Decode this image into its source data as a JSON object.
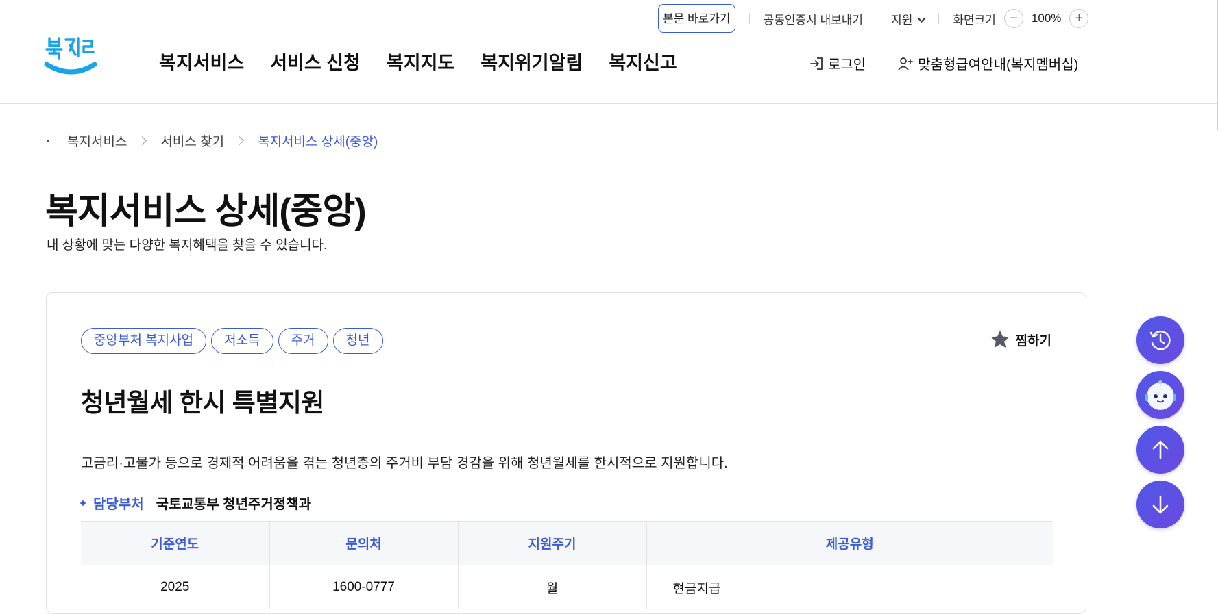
{
  "utility": {
    "skip_link": "본문 바로가기",
    "cert_export": "공동인증서 내보내기",
    "support": "지원",
    "screen_size": "화면크기",
    "zoom_minus": "−",
    "zoom_value": "100%",
    "zoom_plus": "+"
  },
  "header": {
    "logo_text": "복지로",
    "nav": [
      "복지서비스",
      "서비스 신청",
      "복지지도",
      "복지위기알림",
      "복지신고"
    ],
    "login": "로그인",
    "membership": "맞춤형급여안내(복지멤버십)"
  },
  "breadcrumb": {
    "items": [
      "복지서비스",
      "서비스 찾기"
    ],
    "current": "복지서비스 상세(중앙)"
  },
  "page": {
    "title": "복지서비스 상세(중앙)",
    "subtitle": "내 상황에 맞는 다양한 복지혜택을 찾을 수 있습니다."
  },
  "service": {
    "tags": [
      "중앙부처 복지사업",
      "저소득",
      "주거",
      "청년"
    ],
    "bookmark_label": "찜하기",
    "title": "청년월세 한시 특별지원",
    "description": "고금리·고물가 등으로 경제적 어려움을 겪는 청년층의 주거비 부담 경감을 위해 청년월세를 한시적으로 지원합니다.",
    "dept_label": "담당부처",
    "dept_value": "국토교통부 청년주거정책과",
    "table": {
      "headers": [
        "기준연도",
        "문의처",
        "지원주기",
        "제공유형"
      ],
      "row": [
        "2025",
        "1600-0777",
        "월",
        "현금지급"
      ]
    }
  },
  "floating": [
    "recent-history",
    "chatbot",
    "scroll-top",
    "scroll-bottom"
  ],
  "colors": {
    "accent": "#3b5bd6",
    "floating_bg": "#5a52e6",
    "logo_blue": "#1aa3e8"
  }
}
